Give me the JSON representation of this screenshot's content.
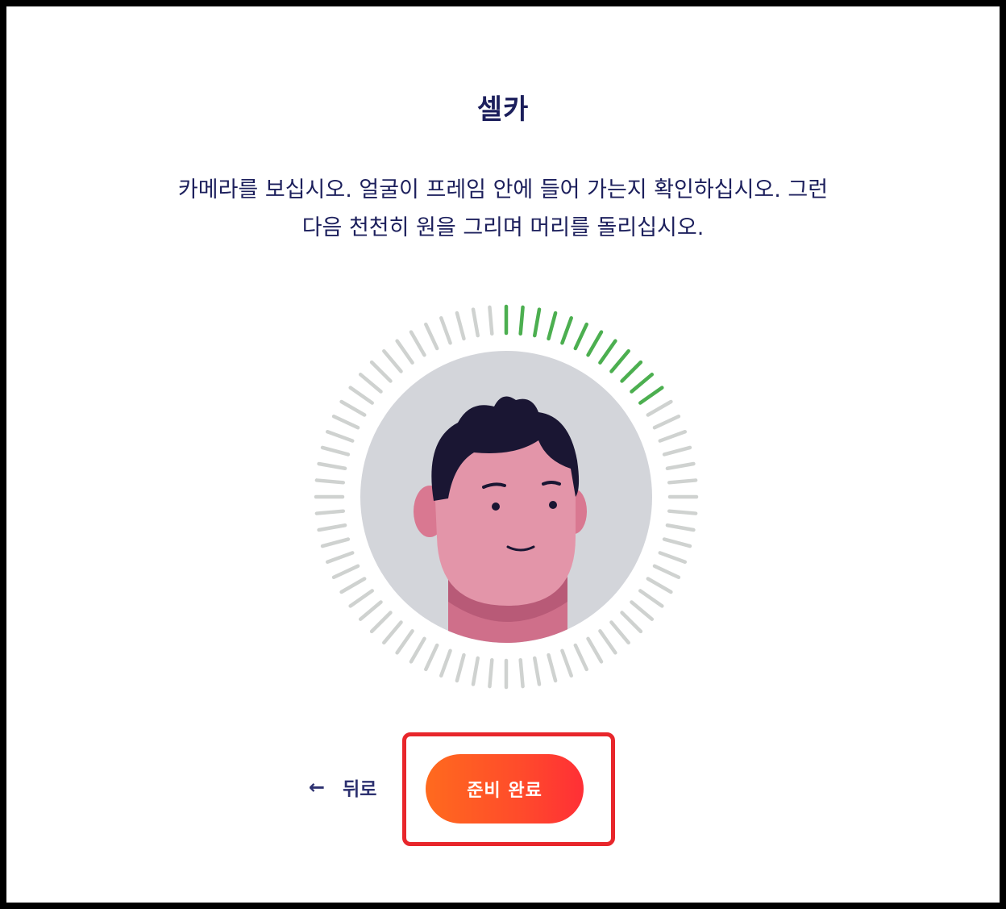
{
  "page": {
    "title": "셀카",
    "instructions_line1": "카메라를 보십시오. 얼굴이 프레임 안에 들어 가는지 확인하십시오. 그런",
    "instructions_line2": "다음 천천히 원을 그리며 머리를 돌리십시오."
  },
  "progress_ring": {
    "total_ticks": 72,
    "completed_ticks": 12,
    "active_color": "#4caf50",
    "inactive_color": "#cfd2d0"
  },
  "avatar": {
    "icon": "face-avatar-illustration",
    "background_color": "#d3d5da",
    "skin_color": "#e395a9",
    "hair_color": "#1a1633"
  },
  "navigation": {
    "back_icon": "arrow-left-icon",
    "back_label": "뒤로",
    "ready_label": "준비 완료",
    "highlight_color": "#e8262b"
  }
}
